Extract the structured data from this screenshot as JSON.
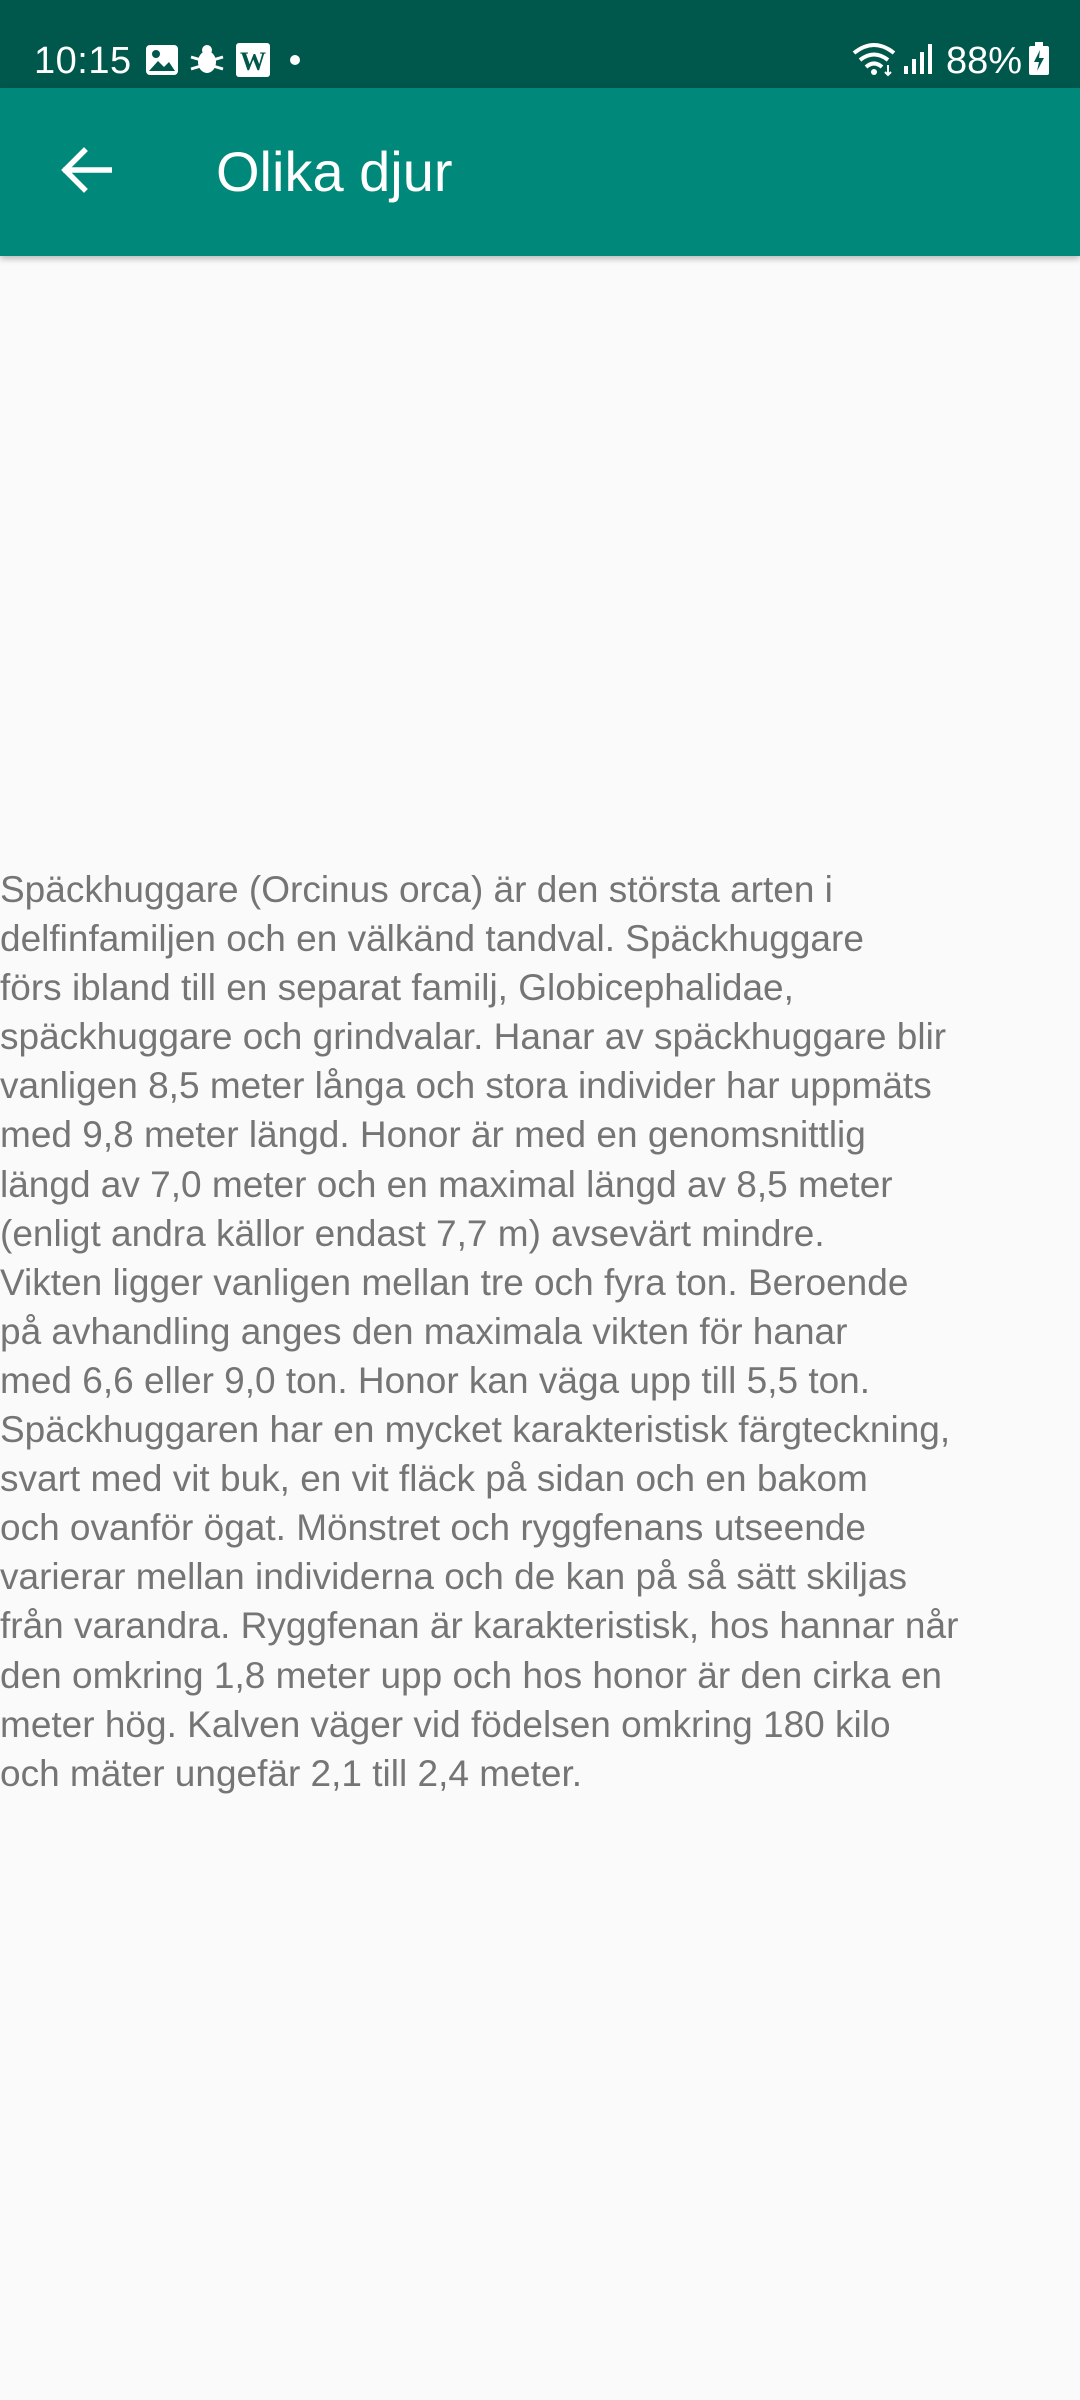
{
  "status_bar": {
    "time": "10:15",
    "battery_percent": "88%",
    "icons_left": [
      "gallery-icon",
      "bug-icon",
      "word-icon",
      "dot-icon"
    ],
    "icons_right": [
      "wifi-icon",
      "signal-icon",
      "battery-charging-icon"
    ],
    "word_icon_letter": "W",
    "background_color": "#00574b"
  },
  "app_bar": {
    "title": "Olika djur",
    "back_icon": "arrow-back-icon",
    "background_color": "#00887a"
  },
  "content": {
    "text": "Späckhuggare (Orcinus orca) är den största arten i\ndelfinfamiljen och en välkänd tandval. Späckhuggare\nförs ibland till en separat familj, Globicephalidae,\nspäckhuggare och grindvalar. Hanar av späckhuggare blir\nvanligen 8,5 meter långa och stora individer har uppmäts\nmed 9,8 meter längd. Honor är med en genomsnittlig\nlängd av 7,0 meter och en maximal längd av 8,5 meter\n(enligt andra källor endast 7,7 m) avsevärt mindre.\nVikten ligger vanligen mellan tre och fyra ton. Beroende\npå avhandling anges den maximala vikten för hanar\nmed 6,6 eller 9,0 ton. Honor kan väga upp till 5,5 ton.\nSpäckhuggaren har en mycket karakteristisk färgteckning,\nsvart med vit buk, en vit fläck på sidan och en bakom\noch ovanför ögat. Mönstret och ryggfenans utseende\nvarierar mellan individerna och de kan på så sätt skiljas\nfrån varandra. Ryggfenan är karakteristisk, hos hannar når\nden omkring 1,8 meter upp och hos honor är den cirka en\nmeter hög.  Kalven väger vid födelsen omkring 180 kilo\noch mäter ungefär 2,1 till 2,4 meter."
  }
}
